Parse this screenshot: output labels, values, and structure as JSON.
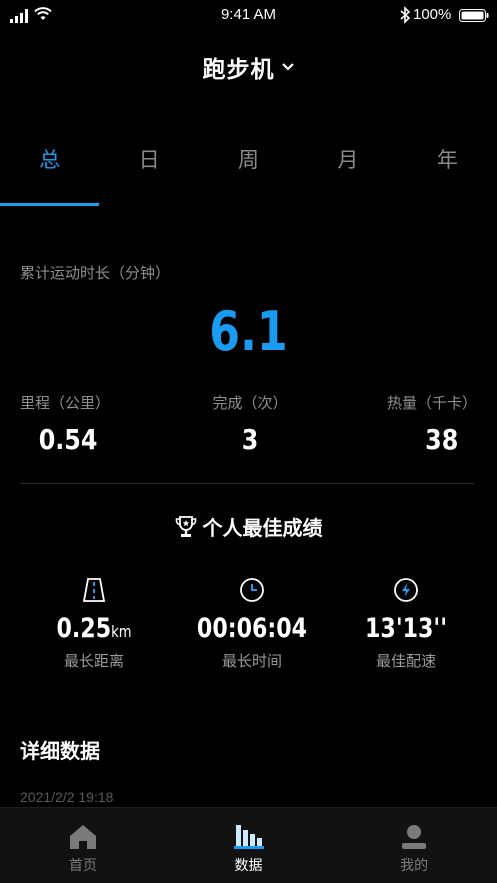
{
  "status_bar": {
    "time": "9:41 AM",
    "battery_percent": "100%"
  },
  "header": {
    "title": "跑步机"
  },
  "tabs": [
    {
      "label": "总",
      "active": true
    },
    {
      "label": "日",
      "active": false
    },
    {
      "label": "周",
      "active": false
    },
    {
      "label": "月",
      "active": false
    },
    {
      "label": "年",
      "active": false
    }
  ],
  "summary": {
    "cumulative_label": "累计运动时长（分钟）",
    "cumulative_value": "6.1",
    "stats": [
      {
        "label": "里程（公里）",
        "value": "0.54"
      },
      {
        "label": "完成（次）",
        "value": "3"
      },
      {
        "label": "热量（千卡）",
        "value": "38"
      }
    ]
  },
  "best": {
    "title": "个人最佳成绩",
    "records": [
      {
        "icon": "road-icon",
        "value": "0.25",
        "unit": "km",
        "label": "最长距离"
      },
      {
        "icon": "clock-icon",
        "value": "00:06:04",
        "unit": "",
        "label": "最长时间"
      },
      {
        "icon": "lightning-icon",
        "value": "13'13''",
        "unit": "",
        "label": "最佳配速"
      }
    ]
  },
  "detail": {
    "title": "详细数据",
    "date": "2021/2/2 19:18"
  },
  "bottom_nav": [
    {
      "label": "首页",
      "icon": "home-icon",
      "active": false
    },
    {
      "label": "数据",
      "icon": "bar-chart-icon",
      "active": true
    },
    {
      "label": "我的",
      "icon": "user-icon",
      "active": false
    }
  ],
  "colors": {
    "accent": "#1a9bf0",
    "background": "#000000",
    "muted_text": "#8f8f8f"
  }
}
